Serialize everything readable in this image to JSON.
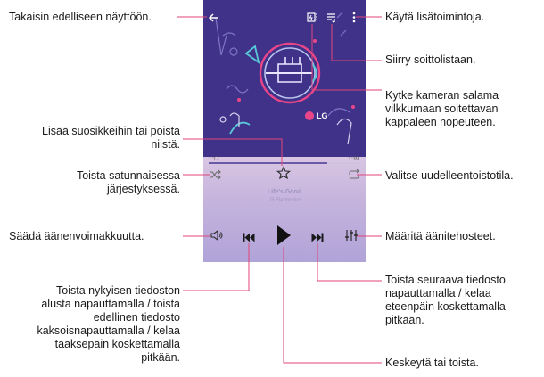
{
  "labels": {
    "back": "Takaisin edelliseen näyttöön.",
    "more": "Käytä lisätoimintoja.",
    "playlist": "Siirry soittolistaan.",
    "flash": [
      "Kytke kameran salama",
      "vilkkumaan soitettavan",
      "kappaleen nopeuteen."
    ],
    "favorite": [
      "Lisää suosikkeihin tai poista",
      "niistä."
    ],
    "shuffle": [
      "Toista satunnaisessa",
      "järjestyksessä."
    ],
    "repeat": "Valitse uudelleentoistotila.",
    "volume": "Säädä äänenvoimakkuutta.",
    "effects": "Määritä äänitehosteet.",
    "next": [
      "Toista seuraava tiedosto",
      "napauttamalla / kelaa",
      "eteenpäin koskettamalla",
      "pitkään."
    ],
    "previous": [
      "Toista nykyisen tiedoston",
      "alusta napauttamalla / toista",
      "edellinen tiedosto",
      "kaksoisnapauttamalla / kelaa",
      "taaksepäin koskettamalla",
      "pitkään."
    ],
    "play_pause": "Keskeytä tai toista."
  },
  "player": {
    "brand": "LG",
    "time_elapsed": "1:17",
    "time_total": "1:39",
    "progress_fraction": 0.78,
    "song_title": "Life's Good",
    "song_artist": "LG Electronics",
    "icons": {
      "back": "back-arrow-icon",
      "flash": "flash-icon",
      "playlist": "playlist-icon",
      "more": "more-vertical-icon",
      "favorite": "star-outline-icon",
      "shuffle": "shuffle-icon",
      "repeat": "repeat-icon",
      "volume": "volume-icon",
      "previous": "previous-icon",
      "play": "play-icon",
      "next": "next-icon",
      "effects": "equalizer-icon"
    }
  },
  "colors": {
    "art_background": "#3a2f80",
    "accent_pink": "#e9468a",
    "accent_cyan": "#58c8d8"
  }
}
